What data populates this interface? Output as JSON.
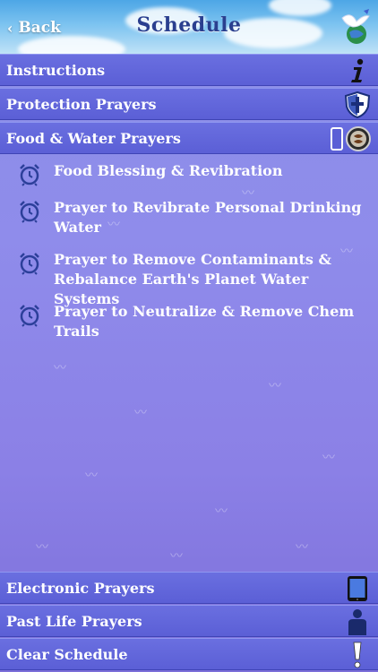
{
  "header": {
    "back_label": "Back",
    "title": "Schedule"
  },
  "top_categories": [
    {
      "label": "Instructions",
      "icon": "info-icon"
    },
    {
      "label": "Protection Prayers",
      "icon": "shield-icon"
    },
    {
      "label": "Food & Water Prayers",
      "icon": "food-water-icon"
    }
  ],
  "prayers": [
    {
      "text": "Food Blessing & Revibration"
    },
    {
      "text": "Prayer to Revibrate Personal Drinking Water"
    },
    {
      "text": "Prayer to Remove Contaminants & Rebalance Earth's Planet Water Systems"
    },
    {
      "text": "Prayer to Neutralize & Remove Chem Trails"
    }
  ],
  "bottom_categories": [
    {
      "label": "Electronic Prayers",
      "icon": "tablet-icon"
    },
    {
      "label": "Past Life Prayers",
      "icon": "person-icon"
    },
    {
      "label": "Clear Schedule",
      "icon": "exclamation-icon"
    }
  ],
  "colors": {
    "row_bg": "#5b5fd6",
    "header_sky": "#4da6e6",
    "title_text": "#2a3f8f",
    "clock_icon": "#2c3f9a"
  }
}
